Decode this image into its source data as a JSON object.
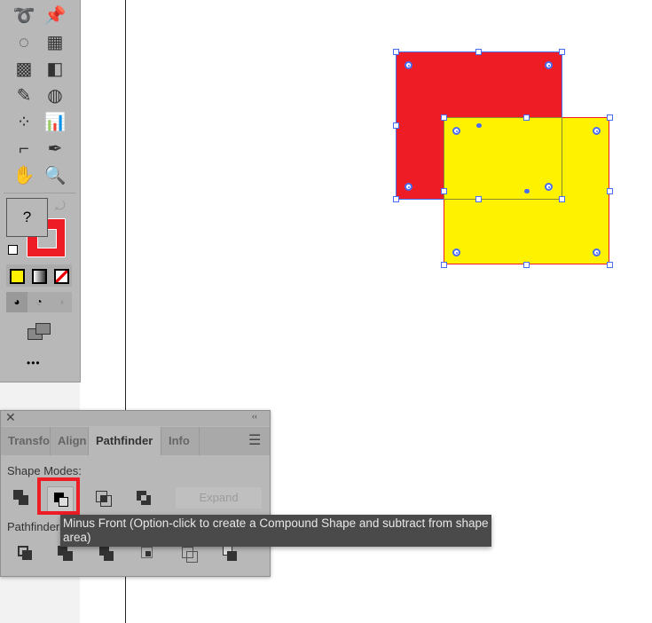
{
  "toolbar": {
    "tools": [
      "curvature-tool",
      "pin-tool",
      "shape-builder-tool",
      "perspective-grid-tool",
      "mesh-tool",
      "gradient-tool",
      "eyedropper-tool",
      "blend-tool",
      "symbol-sprayer-tool",
      "column-graph-tool",
      "artboard-tool",
      "pen-tool",
      "hand-tool",
      "zoom-tool"
    ],
    "fill_label": "?",
    "fill_color": "#b8b8b8",
    "stroke_color": "#ee1c25",
    "more": "•••"
  },
  "panel": {
    "tabs": [
      "Transform",
      "Align",
      "Pathfinder",
      "Info"
    ],
    "active_tab": "Pathfinder",
    "shape_modes_label": "Shape Modes:",
    "expand_label": "Expand",
    "pathfinders_label": "Pathfinders:",
    "tooltip": "Minus Front (Option-click to create a Compound Shape and subtract from shape area)",
    "highlight_color": "#ee1c25"
  },
  "canvas": {
    "red_shape_color": "#ee1c25",
    "yellow_shape_color": "#fff200",
    "selection_color": "#4a6cf0"
  }
}
